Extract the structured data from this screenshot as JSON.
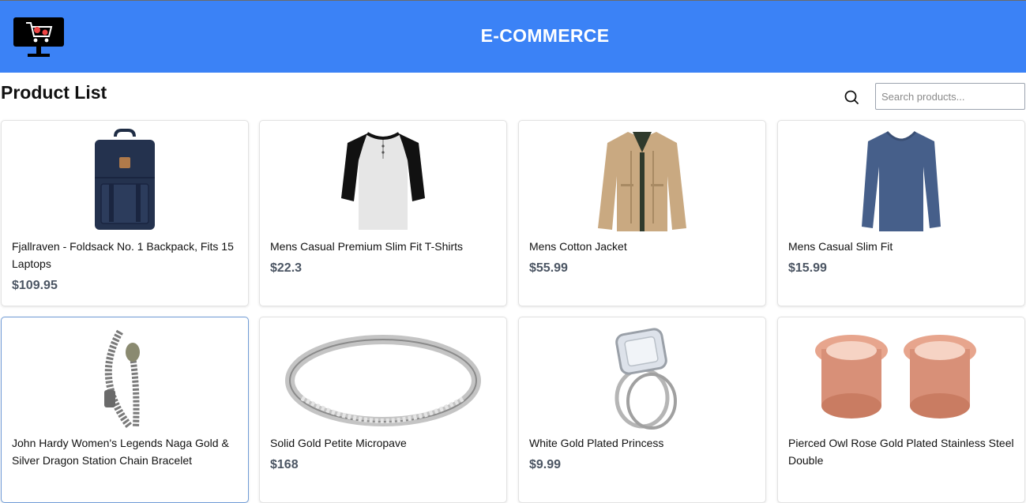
{
  "header": {
    "brand": "E-COMMERCE",
    "logo_icon": "shopping-cart-monitor-icon"
  },
  "page": {
    "title": "Product List"
  },
  "search": {
    "icon": "search-icon",
    "placeholder": "Search products..."
  },
  "products": [
    {
      "title": "Fjallraven - Foldsack No. 1 Backpack, Fits 15 Laptops",
      "price": "$109.95",
      "image": "backpack"
    },
    {
      "title": "Mens Casual Premium Slim Fit T-Shirts",
      "price": "$22.3",
      "image": "raglan-tshirt"
    },
    {
      "title": "Mens Cotton Jacket",
      "price": "$55.99",
      "image": "cotton-jacket"
    },
    {
      "title": "Mens Casual Slim Fit",
      "price": "$15.99",
      "image": "long-sleeve-shirt"
    },
    {
      "title": "John Hardy Women's Legends Naga Gold & Silver Dragon Station Chain Bracelet",
      "price": "",
      "image": "dragon-bracelet"
    },
    {
      "title": "Solid Gold Petite Micropave",
      "price": "$168",
      "image": "micropave-ring"
    },
    {
      "title": "White Gold Plated Princess",
      "price": "$9.99",
      "image": "princess-ring"
    },
    {
      "title": "Pierced Owl Rose Gold Plated Stainless Steel Double",
      "price": "",
      "image": "rose-gold-plugs"
    }
  ],
  "colors": {
    "header_bg": "#3b82f6",
    "price_text": "#4b5563",
    "active_border": "#6f9bd6"
  }
}
